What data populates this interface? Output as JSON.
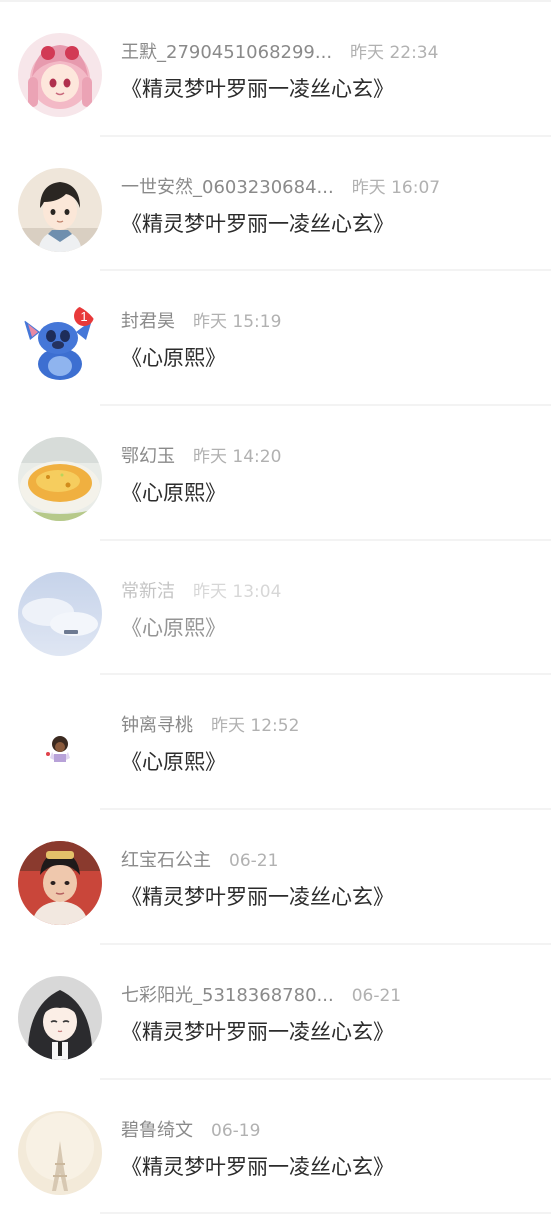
{
  "messages": [
    {
      "name": "王默_2790451068299...",
      "time": "昨天 22:34",
      "text": "《精灵梦叶罗丽一凌丝心玄》",
      "avatar_icon": "anime-girl-pink-hair-avatar"
    },
    {
      "name": "一世安然_0603230684...",
      "time": "昨天 16:07",
      "text": "《精灵梦叶罗丽一凌丝心玄》",
      "avatar_icon": "anime-boy-avatar"
    },
    {
      "name": "封君昊",
      "time": "昨天 15:19",
      "text": "《心原熙》",
      "avatar_icon": "stitch-cartoon-avatar"
    },
    {
      "name": "鄂幻玉",
      "time": "昨天 14:20",
      "text": "《心原熙》",
      "avatar_icon": "custard-bowl-avatar"
    },
    {
      "name": "常新洁",
      "time": "昨天 13:04",
      "text": "《心原熙》",
      "avatar_icon": "sky-cloud-avatar"
    },
    {
      "name": "钟离寻桃",
      "time": "昨天 12:52",
      "text": "《心原熙》",
      "avatar_icon": "small-character-avatar"
    },
    {
      "name": "红宝石公主",
      "time": "06-21",
      "text": "《精灵梦叶罗丽一凌丝心玄》",
      "avatar_icon": "girl-costume-photo-avatar"
    },
    {
      "name": "七彩阳光_5318368780...",
      "time": "06-21",
      "text": "《精灵梦叶罗丽一凌丝心玄》",
      "avatar_icon": "anime-girl-dark-hair-avatar"
    },
    {
      "name": "碧鲁绮文",
      "time": "06-19",
      "text": "《精灵梦叶罗丽一凌丝心玄》",
      "avatar_icon": "eiffel-tower-avatar"
    }
  ]
}
